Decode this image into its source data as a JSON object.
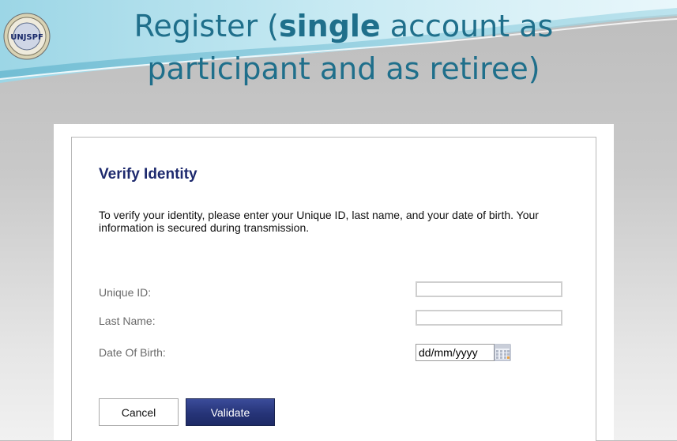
{
  "slide": {
    "title_part1": "Register (",
    "title_bold": "single",
    "title_part2": " account as participant and as retiree)",
    "logo_text": "UNJSPF"
  },
  "form": {
    "heading": "Verify Identity",
    "instructions": "To verify your identity, please enter your Unique ID, last name, and your date of birth. Your information is secured during transmission.",
    "fields": {
      "unique_id": {
        "label": "Unique ID:",
        "value": ""
      },
      "last_name": {
        "label": "Last Name:",
        "value": ""
      },
      "dob": {
        "label": "Date Of Birth:",
        "value": "dd/mm/yyyy"
      }
    },
    "buttons": {
      "cancel": "Cancel",
      "validate": "Validate"
    }
  },
  "colors": {
    "title": "#1f6f8b",
    "heading": "#1e2a6e",
    "validate_button": "#263478"
  }
}
